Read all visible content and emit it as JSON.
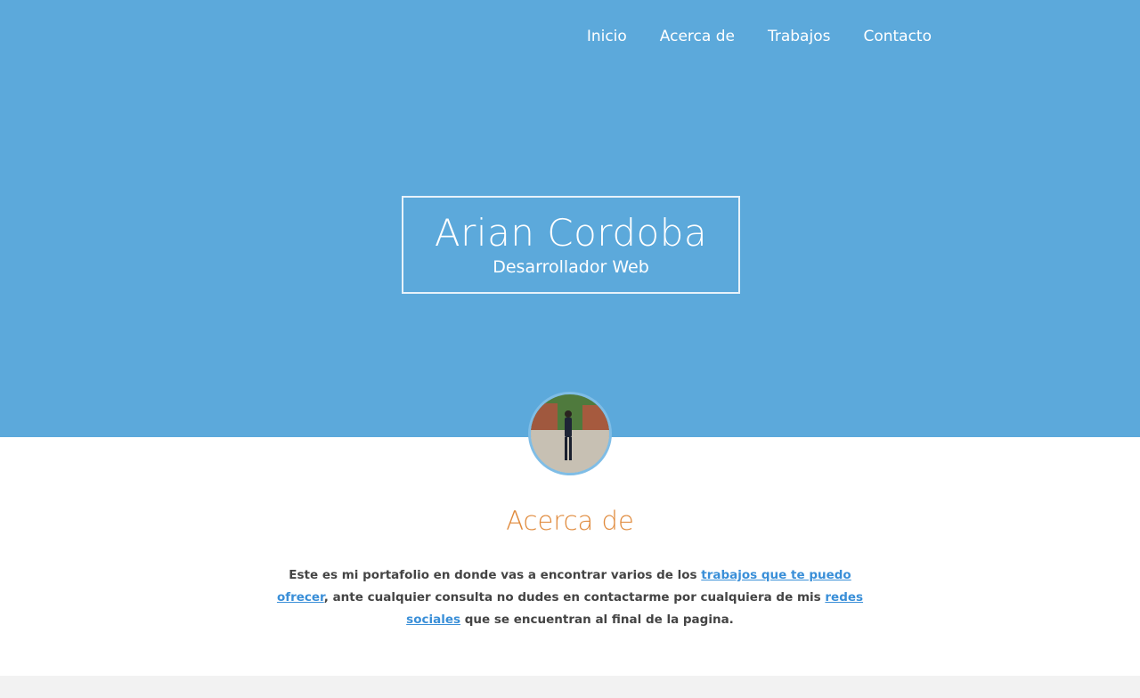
{
  "nav": {
    "items": [
      {
        "label": "Inicio"
      },
      {
        "label": "Acerca de"
      },
      {
        "label": "Trabajos"
      },
      {
        "label": "Contacto"
      }
    ]
  },
  "hero": {
    "name": "Arian Cordoba",
    "role": "Desarrollador Web"
  },
  "about": {
    "title": "Acerca de",
    "text_part1": "Este es mi portafolio en donde vas a encontrar varios de los ",
    "link1": "trabajos que te puedo ofrecer",
    "text_part2": ", ante cualquier consulta no dudes en contactarme por cualquiera de mis ",
    "link2": "redes sociales",
    "text_part3": " que se encuentran al final de la pagina."
  },
  "colors": {
    "hero_bg": "#5ca9db",
    "accent_orange": "#e08a3c",
    "link_blue": "#3a8fd8"
  }
}
